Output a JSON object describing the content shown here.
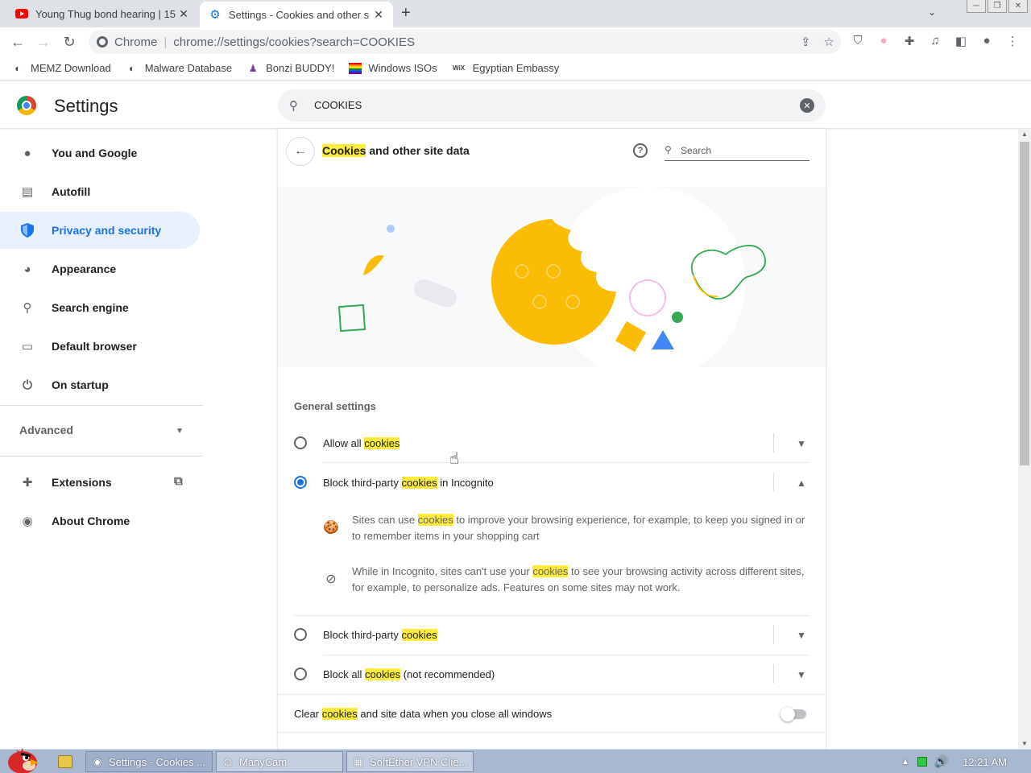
{
  "tabs": [
    {
      "title": "Young Thug bond hearing | 15",
      "icon": "youtube-icon",
      "color": "#ff0000"
    },
    {
      "title": "Settings - Cookies and other s",
      "icon": "gear-icon",
      "color": "#1a73e8"
    }
  ],
  "toolbar": {
    "site_label": "Chrome",
    "url": "chrome://settings/cookies?search=COOKIES"
  },
  "bookmarks": [
    {
      "label": "MEMZ Download",
      "icon": "globe-icon"
    },
    {
      "label": "Malware Database",
      "icon": "globe-icon"
    },
    {
      "label": "Bonzi BUDDY!",
      "icon": "bonzi-icon"
    },
    {
      "label": "Windows ISOs",
      "icon": "rainbow-icon"
    },
    {
      "label": "Egyptian Embassy",
      "icon": "wix-icon",
      "icon_text": "WiX"
    }
  ],
  "header": {
    "title": "Settings",
    "search_value": "COOKIES"
  },
  "sidebar": {
    "items": [
      {
        "label": "You and Google",
        "icon": "person-icon"
      },
      {
        "label": "Autofill",
        "icon": "clipboard-icon"
      },
      {
        "label": "Privacy and security",
        "icon": "shield-icon",
        "active": true
      },
      {
        "label": "Appearance",
        "icon": "palette-icon"
      },
      {
        "label": "Search engine",
        "icon": "search-icon"
      },
      {
        "label": "Default browser",
        "icon": "browser-icon"
      },
      {
        "label": "On startup",
        "icon": "power-icon"
      }
    ],
    "advanced_label": "Advanced",
    "extensions_label": "Extensions",
    "about_label": "About Chrome"
  },
  "page": {
    "title_highlight": "Cookies",
    "title_rest": " and other site data",
    "search_placeholder": "Search",
    "general_settings": "General settings",
    "options": [
      {
        "pre": "Allow all ",
        "hl": "cookies",
        "post": "",
        "checked": false,
        "expanded": false
      },
      {
        "pre": "Block third-party ",
        "hl": "cookies",
        "post": " in Incognito",
        "checked": true,
        "expanded": true
      },
      {
        "pre": "Block third-party ",
        "hl": "cookies",
        "post": "",
        "checked": false,
        "expanded": false
      },
      {
        "pre": "Block all ",
        "hl": "cookies",
        "post": " (not recommended)",
        "checked": false,
        "expanded": false
      }
    ],
    "details": [
      {
        "pre": "Sites can use ",
        "hl": "cookies",
        "post": " to improve your browsing experience, for example, to keep you signed in or to remember items in your shopping cart",
        "icon": "cookie-icon"
      },
      {
        "pre": "While in Incognito, sites can't use your ",
        "hl": "cookies",
        "post": " to see your browsing activity across different sites, for example, to personalize ads. Features on some sites may not work.",
        "icon": "block-icon"
      }
    ],
    "clear_pre": "Clear ",
    "clear_hl": "cookies",
    "clear_post": " and site data when you close all windows",
    "clear_enabled": false
  },
  "taskbar": {
    "buttons": [
      {
        "label": "Settings - Cookies ...",
        "active": true
      },
      {
        "label": "ManyCam",
        "active": false
      },
      {
        "label": "SoftEther VPN Clie...",
        "active": false
      }
    ],
    "clock": "12:21 AM"
  },
  "colors": {
    "accent": "#1a73e8",
    "highlight": "#ffeb3b",
    "cookie": "#fbbc04"
  }
}
